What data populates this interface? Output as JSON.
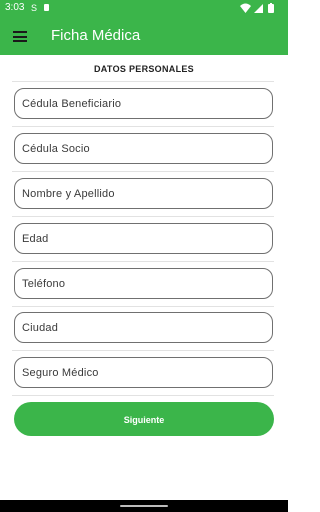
{
  "status_bar": {
    "time": "3:03",
    "icons": [
      "s-app-icon",
      "sim-card-icon",
      "wifi-icon",
      "signal-icon",
      "battery-icon"
    ]
  },
  "app_bar": {
    "title": "Ficha Médica",
    "menu_icon": "hamburger-menu-icon",
    "color": "#3bb54a"
  },
  "form": {
    "section_header": "DATOS PERSONALES",
    "fields": [
      {
        "placeholder": "Cédula Beneficiario",
        "value": ""
      },
      {
        "placeholder": "Cédula Socio",
        "value": ""
      },
      {
        "placeholder": "Nombre y Apellido",
        "value": ""
      },
      {
        "placeholder": "Edad",
        "value": ""
      },
      {
        "placeholder": "Teléfono",
        "value": ""
      },
      {
        "placeholder": "Ciudad",
        "value": ""
      },
      {
        "placeholder": "Seguro Médico",
        "value": ""
      }
    ],
    "next_label": "Siguiente"
  }
}
